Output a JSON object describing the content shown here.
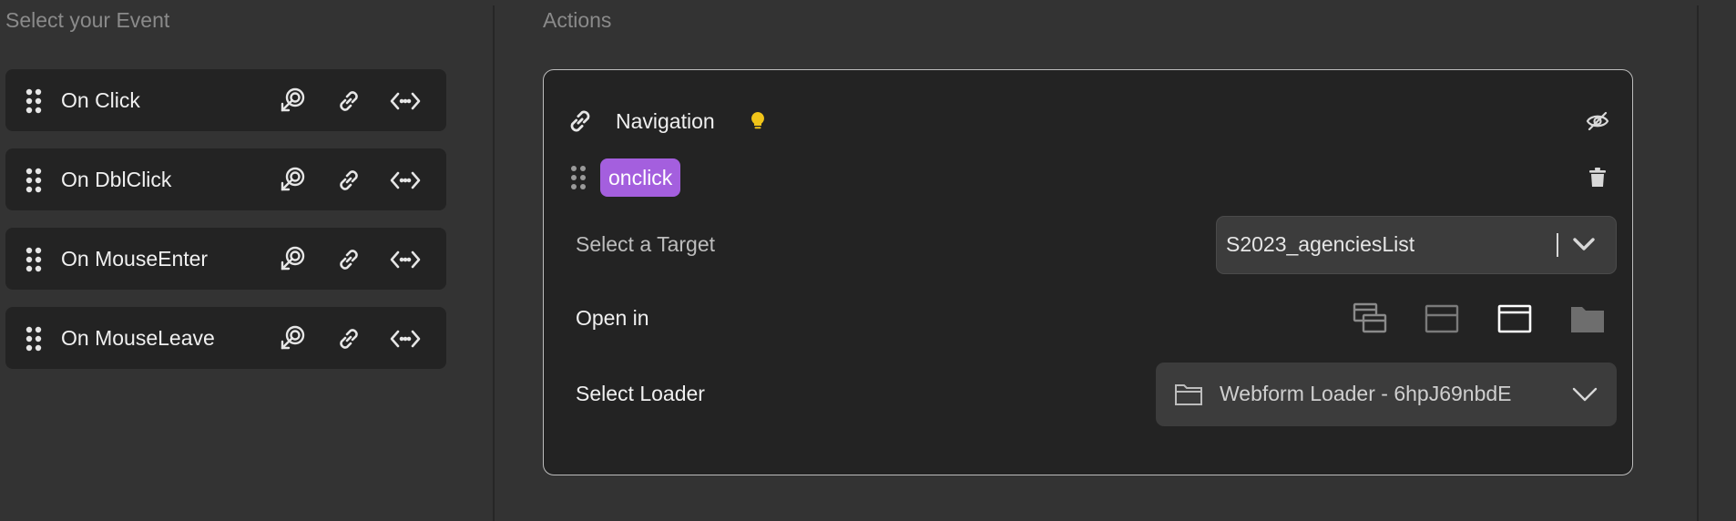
{
  "events_panel": {
    "title": "Select your Event",
    "events": [
      {
        "label": "On Click"
      },
      {
        "label": "On DblClick"
      },
      {
        "label": "On MouseEnter"
      },
      {
        "label": "On MouseLeave"
      }
    ],
    "icons": [
      "drag-handle-icon",
      "pointer-click-icon",
      "link-icon",
      "code-brackets-icon"
    ]
  },
  "actions_panel": {
    "title": "Actions",
    "action": {
      "type_label": "Navigation",
      "event_tag": "onclick",
      "target": {
        "label": "Select a Target",
        "value": "S2023_agenciesList"
      },
      "open_in": {
        "label": "Open in",
        "options": [
          "new-tab-icon",
          "popup-icon",
          "current-tab-icon",
          "folder-icon"
        ],
        "selected_index": 2
      },
      "loader": {
        "label": "Select Loader",
        "value": "Webform Loader - 6hpJ69nbdE"
      }
    }
  },
  "colors": {
    "background": "#333333",
    "row_background": "#232323",
    "tag_purple": "#a45fde",
    "hint_yellow": "#f0c419",
    "muted_text": "#8a8a8a"
  }
}
